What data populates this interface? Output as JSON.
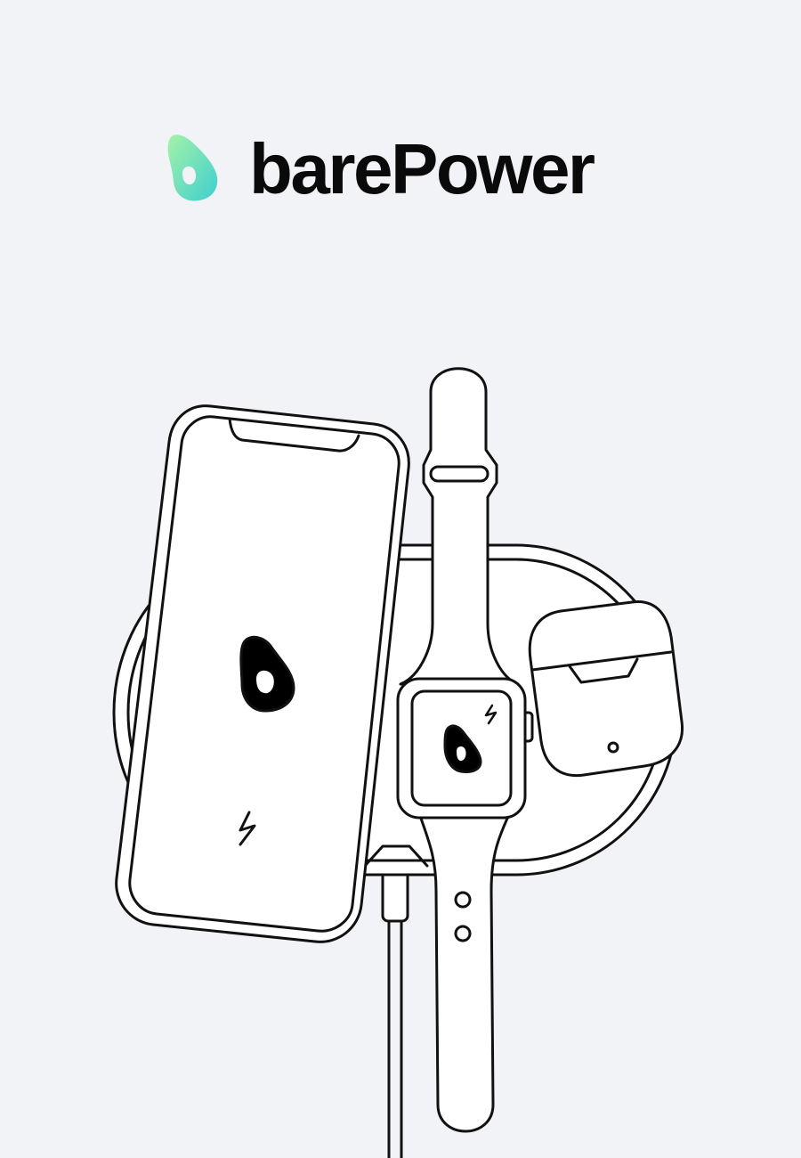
{
  "brand": {
    "name": "barePower",
    "logo_icon": "avocado-drop-icon",
    "logo_gradient": [
      "#8ef0b0",
      "#4fd4c9"
    ],
    "text_color": "#0a0a0a"
  },
  "illustration": {
    "background": "#f2f3f7",
    "stroke_color": "#111111",
    "fill_color": "#ffffff",
    "icons": [
      "phone-icon",
      "smartwatch-icon",
      "earbuds-case-icon",
      "charging-pad-icon",
      "charging-cable-icon",
      "lightning-bolt-icon",
      "avocado-logo-icon"
    ]
  }
}
